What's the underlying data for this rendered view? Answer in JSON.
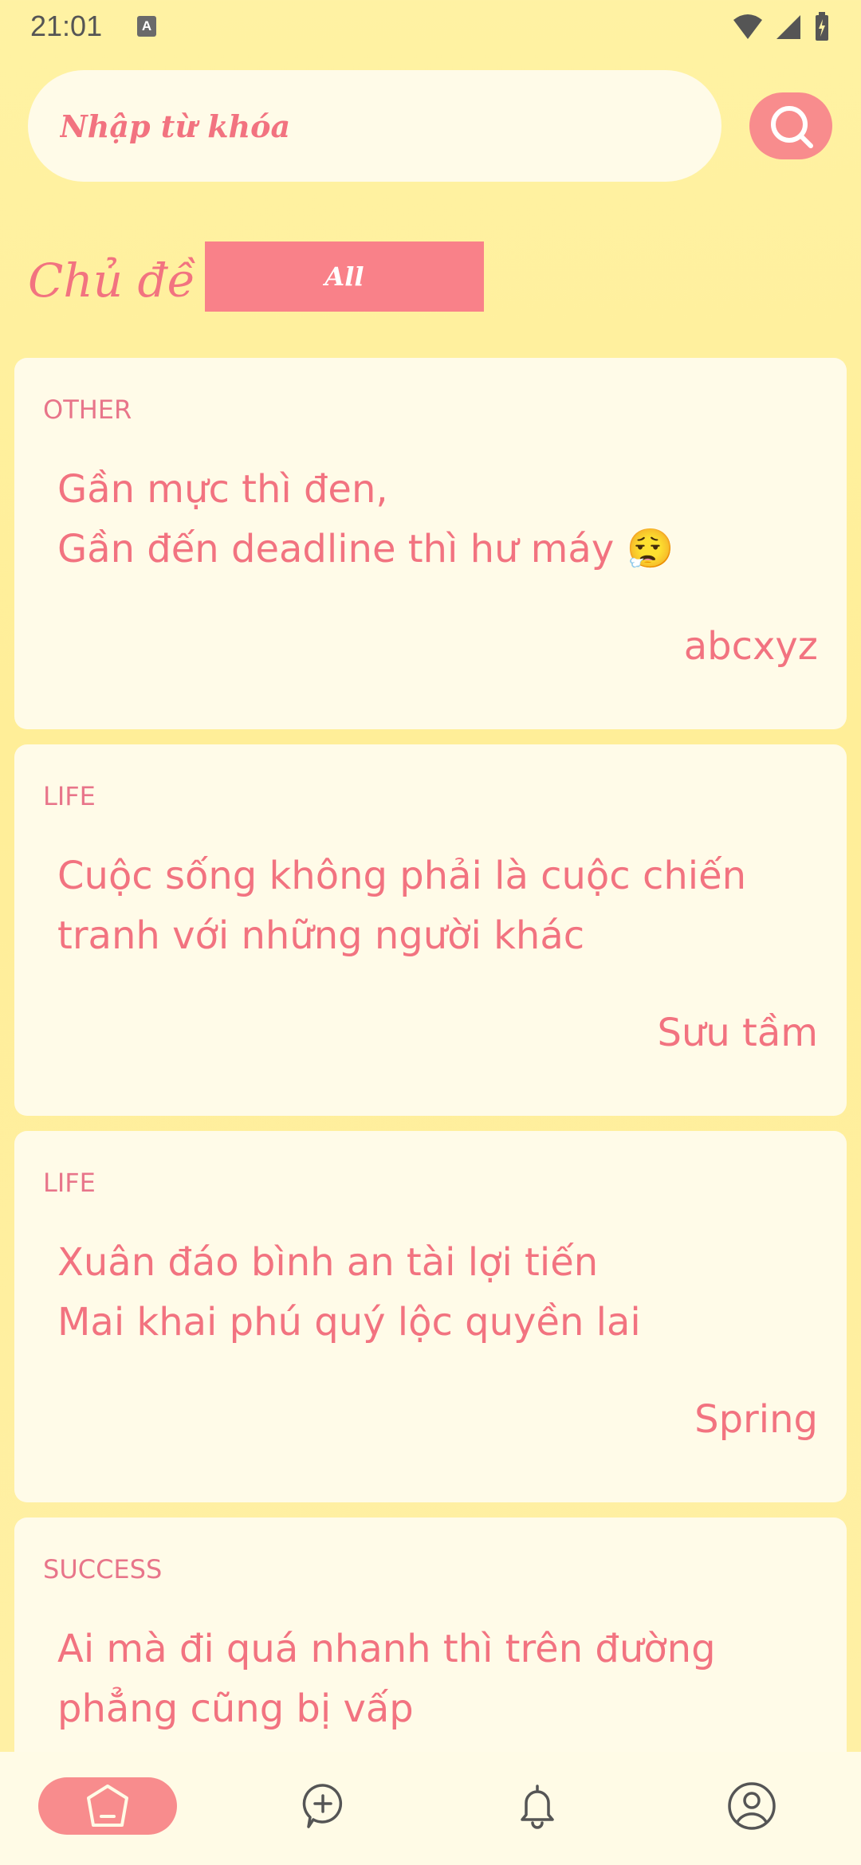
{
  "status_bar": {
    "time": "21:01",
    "notification_badge": "A"
  },
  "search": {
    "placeholder": "Nhập từ khóa"
  },
  "topic": {
    "label": "Chủ đề",
    "selected": "All"
  },
  "cards": [
    {
      "category": "OTHER",
      "quote": "Gần mực thì đen,\nGần đến deadline thì hư máy 😮‍💨",
      "author": "abcxyz"
    },
    {
      "category": "LIFE",
      "quote": "Cuộc sống không phải là cuộc chiến tranh với những người khác",
      "author": "Sưu tầm"
    },
    {
      "category": "LIFE",
      "quote": "Xuân đáo bình an tài lợi tiến\nMai khai phú quý lộc quyền lai",
      "author": "Spring"
    },
    {
      "category": "SUCCESS",
      "quote": "Ai mà đi quá nhanh thì trên đường phẳng cũng bị vấp",
      "author": ""
    }
  ],
  "nav": {
    "items": [
      "home-icon",
      "add-post-icon",
      "bell-icon",
      "profile-icon"
    ],
    "active": "home-icon"
  },
  "colors": {
    "accent": "#F27380",
    "button": "#F88C8D",
    "card": "#FFFBE8",
    "background": "#FFF2A3"
  }
}
